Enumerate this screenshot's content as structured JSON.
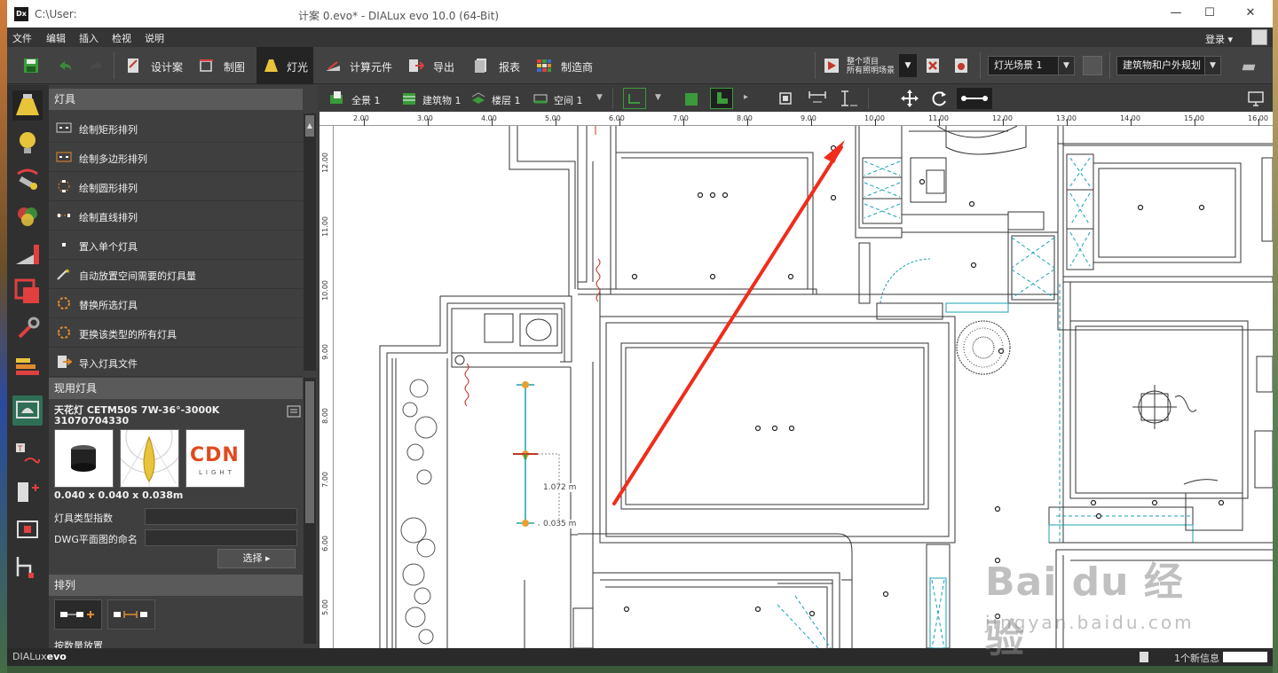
{
  "window": {
    "path": "C:\\User:",
    "title": "计案 0.evo* - DIALux evo 10.0  (64-Bit)",
    "app_icon": "Dx",
    "minimize": "—",
    "maximize": "☐",
    "close": "✕"
  },
  "menu": {
    "items": [
      "文件",
      "编辑",
      "插入",
      "检视",
      "说明"
    ],
    "login": "登录"
  },
  "toolbar": {
    "modes": [
      "设计案",
      "制图",
      "灯光",
      "计算元件",
      "导出",
      "报表",
      "制造商"
    ],
    "active_mode": "灯光",
    "calc_line1": "整个项目",
    "calc_line2": "所有照明场景",
    "light_scene": "灯光场景 1",
    "planning": "建筑物和户外规划"
  },
  "panel": {
    "header": "灯具",
    "items": [
      "绘制矩形排列",
      "绘制多边形排列",
      "绘制圆形排列",
      "绘制直线排列",
      "置入单个灯具",
      "自动放置空间需要的灯具量",
      "替换所选灯具",
      "更换该类型的所有灯具",
      "导入灯具文件"
    ],
    "current_header": "现用灯具",
    "fixture_name": "天花灯 CETM50S 7W-36°-3000K",
    "fixture_code": "31070704330",
    "brand_logo": "CDN",
    "brand_sub": "LIGHT",
    "dimensions": "0.040 x 0.040 x 0.038m",
    "type_index_label": "灯具类型指数",
    "dwg_label": "DWG平面图的命名",
    "select_button": "选择",
    "arrange_header": "排列",
    "cut_label": "按数量放置"
  },
  "view_toolbar": {
    "scope": "全景 1",
    "building": "建筑物 1",
    "floor": "楼层 1",
    "room": "空间 1"
  },
  "rulers": {
    "top": [
      "2.00",
      "3.00",
      "4.00",
      "5.00",
      "6.00",
      "7.00",
      "8.00",
      "9.00",
      "10.00",
      "11.00",
      "12.00",
      "13.00",
      "14.00",
      "15.00",
      "16.00"
    ],
    "left": [
      "12.00",
      "11.00",
      "10.00",
      "9.00",
      "8.00",
      "7.00",
      "6.00",
      "5.00"
    ]
  },
  "plan": {
    "dim1": "1.072 m",
    "dim2": "0.035 m"
  },
  "status": {
    "brand": "DIALux",
    "brand_suffix": "evo",
    "message": "1个新信息"
  },
  "watermark": {
    "text": "Bai du 经验",
    "url": "jingyan.baidu.com"
  },
  "colors": {
    "accent_yellow": "#e8c43a",
    "annotation_red": "#f02c1c",
    "panel_bg": "#3f3f3f",
    "plan_cyan": "#1aa0b4"
  }
}
